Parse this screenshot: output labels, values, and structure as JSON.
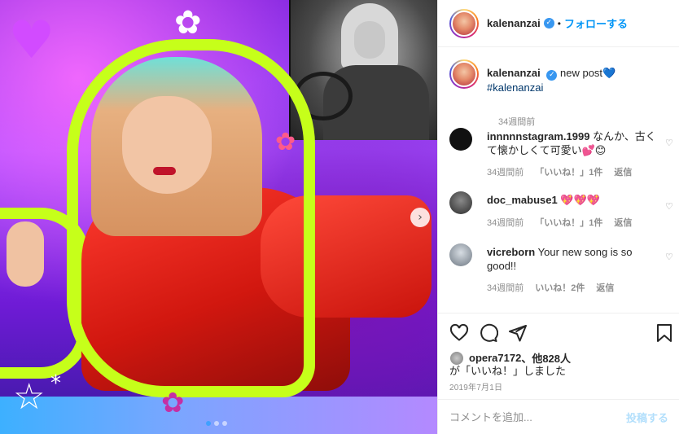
{
  "header": {
    "username": "kalenanzai",
    "separator": "•",
    "follow_label": "フォローする"
  },
  "caption": {
    "username": "kalenanzai",
    "text": "new post💙",
    "hashtag": "#kalenanzai",
    "time": "34週間前"
  },
  "comments": [
    {
      "username": "innnnnstagram.1999",
      "text": "なんか、古くて懐かしくて可愛い💕😊",
      "time": "34週間前",
      "likes": "「いいね！」1件",
      "reply": "返信"
    },
    {
      "username": "doc_mabuse1",
      "text": "💖💖💖",
      "time": "34週間前",
      "likes": "「いいね！」1件",
      "reply": "返信"
    },
    {
      "username": "vicreborn",
      "text": "Your new song is so good!!",
      "time": "34週間前",
      "likes": "いいね！2件",
      "reply": "返信"
    }
  ],
  "likes": {
    "liker": "opera7172",
    "others": "、他828人",
    "line2": "が「いいね！」しました"
  },
  "post_date": "2019年7月1日",
  "comment_box": {
    "placeholder": "コメントを追加...",
    "post_label": "投稿する"
  },
  "icons": {
    "heart": "heart-icon",
    "comment": "comment-icon",
    "share": "share-icon",
    "bookmark": "bookmark-icon",
    "verified": "verified-badge-icon",
    "next": "chevron-right-icon"
  },
  "colors": {
    "link_blue": "#0095f6",
    "muted": "#8e8e8e",
    "lime": "#c6ff1a"
  },
  "carousel": {
    "count": 3,
    "active": 0
  }
}
